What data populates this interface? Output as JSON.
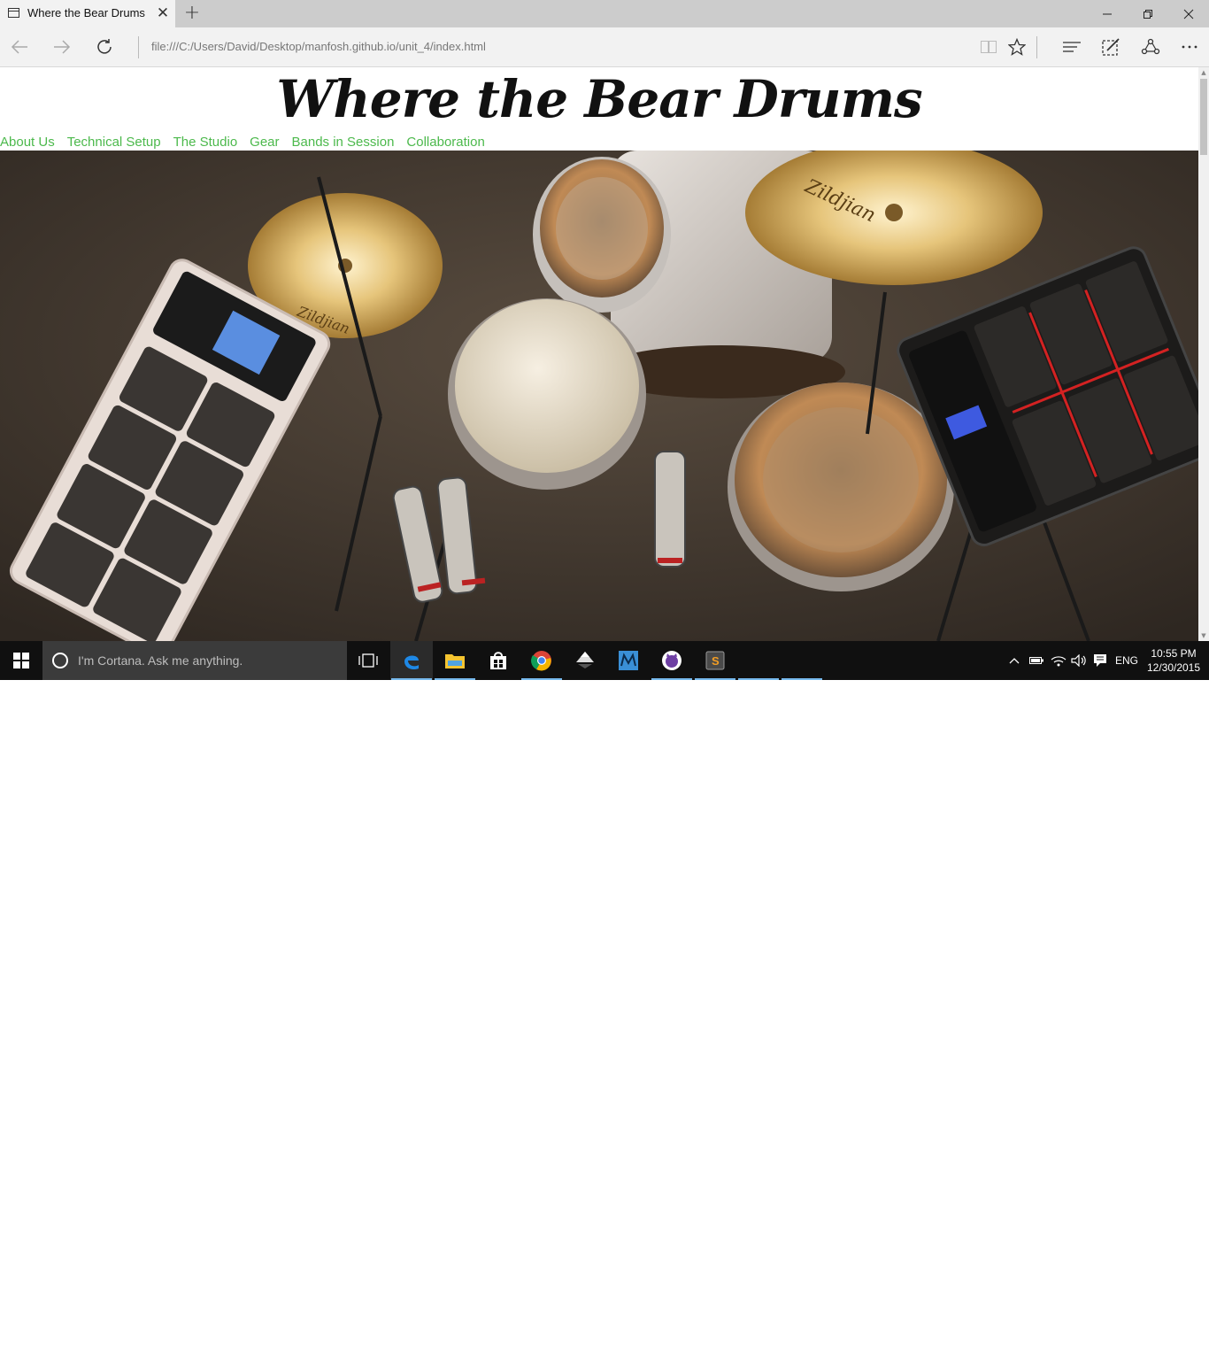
{
  "browser": {
    "tab_title": "Where the Bear Drums",
    "address": "file:///C:/Users/David/Desktop/manfosh.github.io/unit_4/index.html"
  },
  "page": {
    "title": "Where the Bear Drums",
    "nav": [
      {
        "label": "About Us"
      },
      {
        "label": "Technical Setup"
      },
      {
        "label": "The Studio"
      },
      {
        "label": "Gear"
      },
      {
        "label": "Bands in Session"
      },
      {
        "label": "Collaboration"
      }
    ],
    "link_color": "#4cb94c"
  },
  "taskbar": {
    "search_placeholder": "I'm Cortana. Ask me anything.",
    "language": "ENG",
    "time": "10:55 PM",
    "date": "12/30/2015",
    "accent": "#76b9ed",
    "apps": [
      "task-view-icon",
      "edge-icon",
      "file-explorer-icon",
      "store-icon",
      "chrome-icon",
      "inkscape-icon",
      "vmware-icon",
      "github-icon",
      "sublime-text-icon"
    ]
  }
}
